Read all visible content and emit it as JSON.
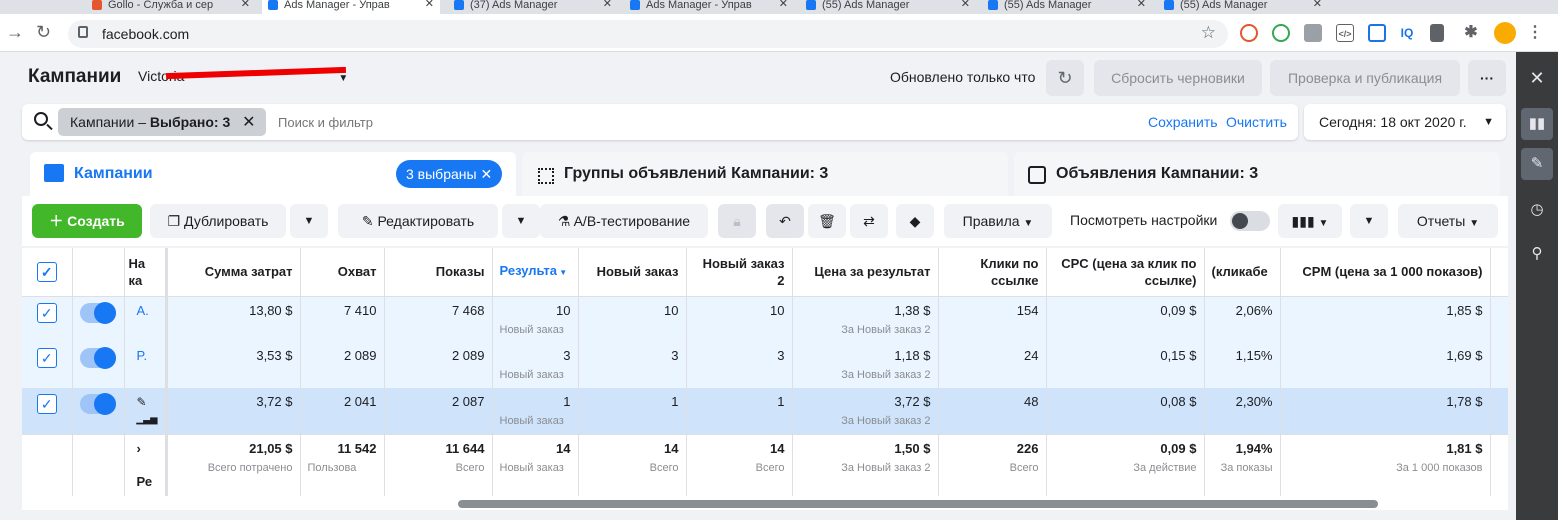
{
  "browser": {
    "tabs": [
      "Gollo - Служба и сер",
      "Ads Manager - Управ",
      "(37) Ads Manager",
      "Ads Manager - Управ",
      "(55) Ads Manager",
      "(55) Ads Manager",
      "(55) Ads Manager"
    ],
    "url": "facebook.com"
  },
  "header": {
    "title": "Кампании",
    "account": "Victoria",
    "updated": "Обновлено только что",
    "reset_drafts": "Сбросить черновики",
    "review_publish": "Проверка и публикация",
    "more": "···"
  },
  "search": {
    "chip": "Кампании – ",
    "chip_bold": "Выбрано: 3",
    "placeholder": "Поиск и фильтр",
    "save": "Сохранить",
    "clear": "Очистить",
    "date": "Сегодня: 18 окт 2020 г."
  },
  "tabs": {
    "campaigns": "Кампании",
    "selected_badge": "3 выбраны",
    "adsets": "Группы объявлений Кампании: 3",
    "ads": "Объявления Кампании: 3"
  },
  "toolbar": {
    "create": "Создать",
    "duplicate": "Дублировать",
    "edit": "Редактировать",
    "ab_test": "A/B-тестирование",
    "rules": "Правила",
    "view_settings": "Посмотреть настройки",
    "reports": "Отчеты"
  },
  "table": {
    "headers": [
      "На ка",
      "Сумма затрат",
      "Охват",
      "Показы",
      "Результа",
      "Новый заказ",
      "Новый заказ 2",
      "Цена за результат",
      "Клики по ссылке",
      "CPC (цена за клик по ссылке)",
      "(кликабе",
      "CPM (цена за 1 000 показов)"
    ],
    "rows": [
      {
        "name": "A.",
        "spend": "13,80 $",
        "reach": "7 410",
        "impr": "7 468",
        "results": "10",
        "results_sub": "Новый заказ",
        "order": "10",
        "order2": "10",
        "cpr": "1,38 $",
        "cpr_sub": "За Новый заказ 2",
        "clicks": "154",
        "cpc": "0,09 $",
        "ctr": "2,06%",
        "cpm": "1,85 $"
      },
      {
        "name": "P.",
        "spend": "3,53 $",
        "reach": "2 089",
        "impr": "2 089",
        "results": "3",
        "results_sub": "Новый заказ",
        "order": "3",
        "order2": "3",
        "cpr": "1,18 $",
        "cpr_sub": "За Новый заказ 2",
        "clicks": "24",
        "cpc": "0,15 $",
        "ctr": "1,15%",
        "cpm": "1,69 $"
      },
      {
        "name": "",
        "spend": "3,72 $",
        "reach": "2 041",
        "impr": "2 087",
        "results": "1",
        "results_sub": "Новый заказ",
        "order": "1",
        "order2": "1",
        "cpr": "3,72 $",
        "cpr_sub": "За Новый заказ 2",
        "clicks": "48",
        "cpc": "0,08 $",
        "ctr": "2,30%",
        "cpm": "1,78 $"
      }
    ],
    "total": {
      "label": "Ре",
      "arrow": "›",
      "spend": "21,05 $",
      "spend_sub": "Всего потрачено",
      "reach": "11 542",
      "reach_sub": "Пользова",
      "impr": "11 644",
      "impr_sub": "Всего",
      "results": "14",
      "results_sub": "Новый заказ",
      "order": "14",
      "order_sub": "Всего",
      "order2": "14",
      "order2_sub": "Всего",
      "cpr": "1,50 $",
      "cpr_sub": "За Новый заказ 2",
      "clicks": "226",
      "clicks_sub": "Всего",
      "cpc": "0,09 $",
      "cpc_sub": "За действие",
      "ctr": "1,94%",
      "ctr_sub": "За показы",
      "cpm": "1,81 $",
      "cpm_sub": "За 1 000 показов"
    }
  },
  "colors": {
    "accent": "#1877f2",
    "create": "#42b72a",
    "selected_row": "#cfe3fb",
    "sidebar": "#3a3b3c"
  }
}
